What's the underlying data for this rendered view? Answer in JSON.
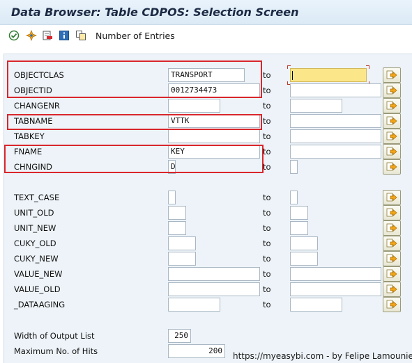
{
  "window": {
    "title": "Data Browser: Table CDPOS: Selection Screen"
  },
  "toolbar": {
    "icons": [
      "execute-icon",
      "selection-options-icon",
      "delete-entry-icon",
      "info-icon",
      "copy-icon"
    ],
    "number_of_entries_label": "Number of Entries"
  },
  "to_label": "to",
  "rows": [
    {
      "label": "OBJECTCLAS",
      "value": "TRANSPORT",
      "to_value": ""
    },
    {
      "label": "OBJECTID",
      "value": "0012734473",
      "to_value": ""
    },
    {
      "label": "CHANGENR",
      "value": "",
      "to_value": ""
    },
    {
      "label": "TABNAME",
      "value": "VTTK",
      "to_value": ""
    },
    {
      "label": "TABKEY",
      "value": "",
      "to_value": ""
    },
    {
      "label": "FNAME",
      "value": "KEY",
      "to_value": ""
    },
    {
      "label": "CHNGIND",
      "value": "D",
      "to_value": ""
    },
    {
      "label": "TEXT_CASE",
      "value": "",
      "to_value": ""
    },
    {
      "label": "UNIT_OLD",
      "value": "",
      "to_value": ""
    },
    {
      "label": "UNIT_NEW",
      "value": "",
      "to_value": ""
    },
    {
      "label": "CUKY_OLD",
      "value": "",
      "to_value": ""
    },
    {
      "label": "CUKY_NEW",
      "value": "",
      "to_value": ""
    },
    {
      "label": "VALUE_NEW",
      "value": "",
      "to_value": ""
    },
    {
      "label": "VALUE_OLD",
      "value": "",
      "to_value": ""
    },
    {
      "label": "_DATAAGING",
      "value": "",
      "to_value": ""
    }
  ],
  "settings": {
    "width_label": "Width of Output List",
    "width_value": "250",
    "max_hits_label": "Maximum No. of Hits",
    "max_hits_value": "200"
  },
  "watermark": "https://myeasybi.com - by Felipe Lamounier",
  "colors": {
    "highlight_box": "#d9262c",
    "active_field": "#fbe68a",
    "panel": "#edf3f8"
  }
}
